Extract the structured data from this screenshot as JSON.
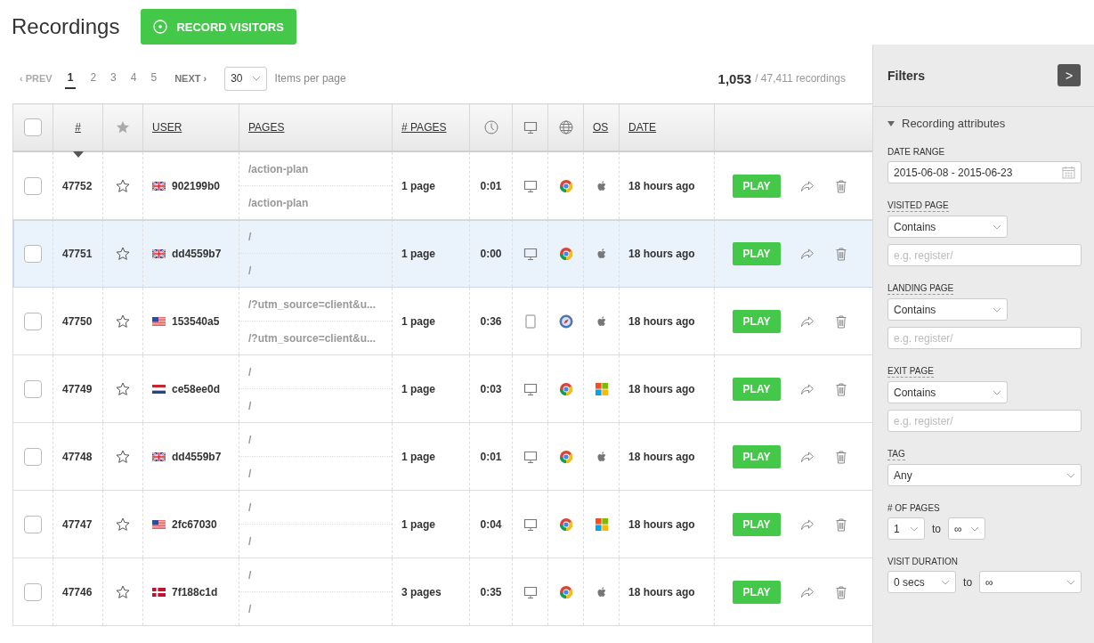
{
  "header": {
    "title": "Recordings",
    "record_button": "RECORD VISITORS"
  },
  "pagination": {
    "prev": "‹ PREV",
    "pages": [
      {
        "label": "1",
        "selected": true
      },
      {
        "label": "2",
        "selected": false
      },
      {
        "label": "3",
        "selected": false
      },
      {
        "label": "4",
        "selected": false
      },
      {
        "label": "5",
        "selected": false
      }
    ],
    "next": "NEXT ›",
    "per_page": "30",
    "per_page_label": "Items per page"
  },
  "summary": {
    "count": "1,053",
    "total": "/ 47,411 recordings"
  },
  "table": {
    "columns": [
      {
        "kind": "checkbox",
        "checked": false
      },
      {
        "kind": "text",
        "label": "#",
        "sorted": true
      },
      {
        "kind": "star"
      },
      {
        "kind": "text",
        "label": "USER"
      },
      {
        "kind": "text",
        "label": "PAGES"
      },
      {
        "kind": "text",
        "label": "# PAGES"
      },
      {
        "kind": "clock"
      },
      {
        "kind": "device"
      },
      {
        "kind": "globe"
      },
      {
        "kind": "text",
        "label": "OS"
      },
      {
        "kind": "text",
        "label": "DATE"
      },
      {
        "kind": "blank"
      }
    ],
    "rows": [
      {
        "checked": false,
        "highlighted": false,
        "id": "47752",
        "starred": false,
        "flag": {
          "kind": "gb"
        },
        "user": "902199b0",
        "pages": [
          "/action-plan",
          "/action-plan"
        ],
        "page_count": "1 page",
        "duration": "0:01",
        "device": {
          "kind": "desktop"
        },
        "browser": {
          "kind": "chrome"
        },
        "os": {
          "kind": "mac"
        },
        "date": "18 hours ago",
        "play": "PLAY"
      },
      {
        "checked": false,
        "highlighted": true,
        "id": "47751",
        "starred": false,
        "flag": {
          "kind": "gb"
        },
        "user": "dd4559b7",
        "pages": [
          "/",
          "/"
        ],
        "page_count": "1 page",
        "duration": "0:00",
        "device": {
          "kind": "desktop"
        },
        "browser": {
          "kind": "chrome"
        },
        "os": {
          "kind": "mac"
        },
        "date": "18 hours ago",
        "play": "PLAY"
      },
      {
        "checked": false,
        "highlighted": false,
        "id": "47750",
        "starred": false,
        "flag": {
          "kind": "us"
        },
        "user": "153540a5",
        "pages": [
          "/?utm_source=client&u...",
          "/?utm_source=client&u..."
        ],
        "page_count": "1 page",
        "duration": "0:36",
        "device": {
          "kind": "tablet"
        },
        "browser": {
          "kind": "safari"
        },
        "os": {
          "kind": "mac"
        },
        "date": "18 hours ago",
        "play": "PLAY"
      },
      {
        "checked": false,
        "highlighted": false,
        "id": "47749",
        "starred": false,
        "flag": {
          "kind": "nl"
        },
        "user": "ce58ee0d",
        "pages": [
          "/",
          "/"
        ],
        "page_count": "1 page",
        "duration": "0:03",
        "device": {
          "kind": "desktop"
        },
        "browser": {
          "kind": "chrome"
        },
        "os": {
          "kind": "windows"
        },
        "date": "18 hours ago",
        "play": "PLAY"
      },
      {
        "checked": false,
        "highlighted": false,
        "id": "47748",
        "starred": false,
        "flag": {
          "kind": "gb"
        },
        "user": "dd4559b7",
        "pages": [
          "/",
          "/"
        ],
        "page_count": "1 page",
        "duration": "0:01",
        "device": {
          "kind": "desktop"
        },
        "browser": {
          "kind": "chrome"
        },
        "os": {
          "kind": "mac"
        },
        "date": "18 hours ago",
        "play": "PLAY"
      },
      {
        "checked": false,
        "highlighted": false,
        "id": "47747",
        "starred": false,
        "flag": {
          "kind": "us"
        },
        "user": "2fc67030",
        "pages": [
          "/",
          "/"
        ],
        "page_count": "1 page",
        "duration": "0:04",
        "device": {
          "kind": "desktop"
        },
        "browser": {
          "kind": "chrome"
        },
        "os": {
          "kind": "windows"
        },
        "date": "18 hours ago",
        "play": "PLAY"
      },
      {
        "checked": false,
        "highlighted": false,
        "id": "47746",
        "starred": false,
        "flag": {
          "kind": "dk"
        },
        "user": "7f188c1d",
        "pages": [
          "/",
          "/"
        ],
        "page_count": "3 pages",
        "duration": "0:35",
        "device": {
          "kind": "desktop"
        },
        "browser": {
          "kind": "chrome"
        },
        "os": {
          "kind": "mac"
        },
        "date": "18 hours ago",
        "play": "PLAY"
      }
    ]
  },
  "filters": {
    "title": "Filters",
    "collapse_button": ">",
    "section": {
      "label": "Recording attributes",
      "expanded": true
    },
    "fields": [
      {
        "kind": "date",
        "label": "DATE RANGE",
        "value": "2015-06-08 - 2015-06-23"
      },
      {
        "kind": "text-filter",
        "label": "VISITED PAGE",
        "operator": "Contains",
        "placeholder": "e.g. register/"
      },
      {
        "kind": "text-filter",
        "label": "LANDING PAGE",
        "operator": "Contains",
        "placeholder": "e.g. register/"
      },
      {
        "kind": "text-filter",
        "label": "EXIT PAGE",
        "operator": "Contains",
        "placeholder": "e.g. register/"
      },
      {
        "kind": "select",
        "label": "TAG",
        "value": "Any"
      },
      {
        "kind": "count-range",
        "label": "# OF PAGES",
        "from": "1",
        "to_label": "to",
        "to": "∞"
      },
      {
        "kind": "duration-range",
        "label": "VISIT DURATION",
        "from": "0 secs",
        "to_label": "to",
        "to": "∞"
      }
    ]
  }
}
